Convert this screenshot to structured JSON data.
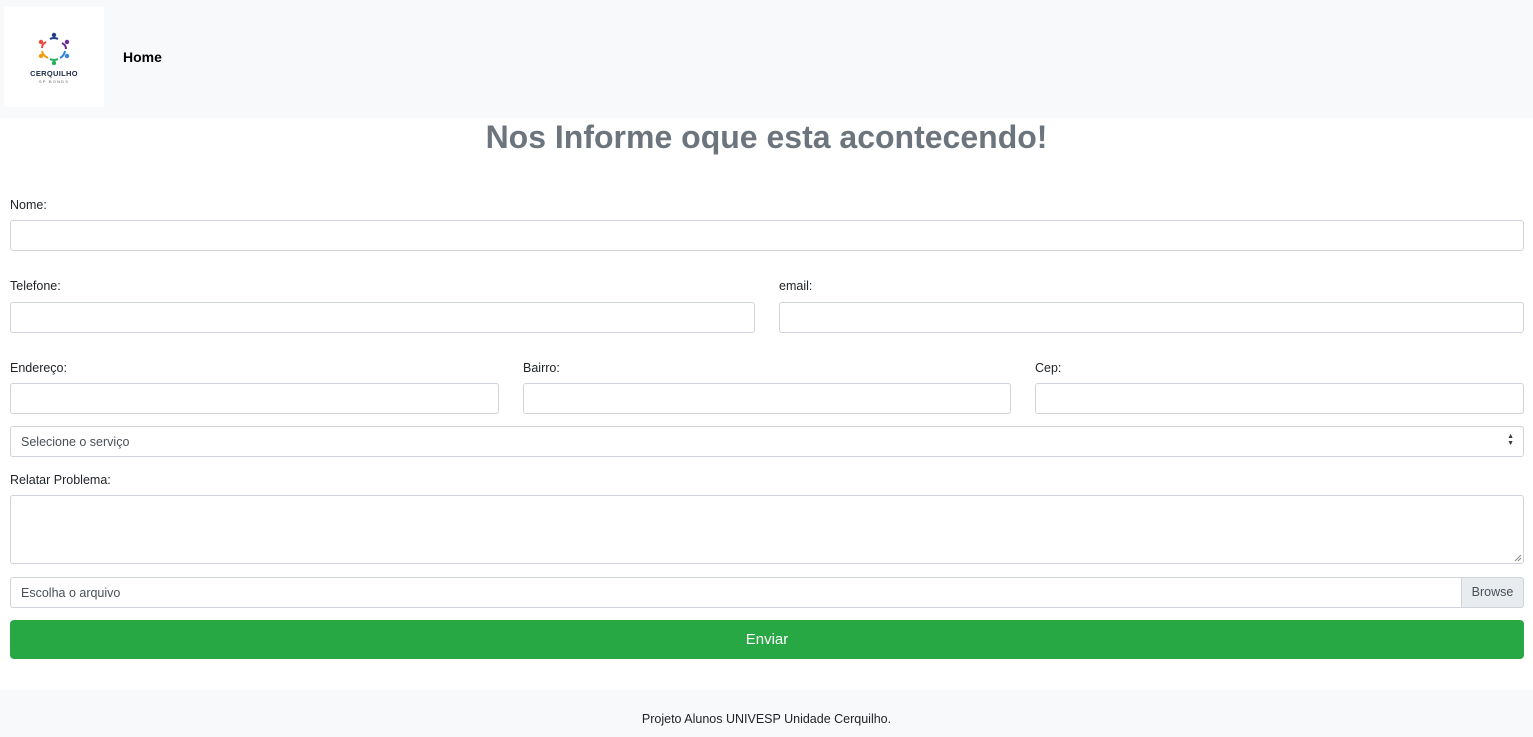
{
  "navbar": {
    "logo_text": "CERQUILHO",
    "logo_subtext": "SP BONDS",
    "home_label": "Home"
  },
  "page": {
    "title": "Nos Informe oque esta acontecendo!"
  },
  "form": {
    "nome_label": "Nome:",
    "nome_value": "",
    "telefone_label": "Telefone:",
    "telefone_value": "",
    "email_label": "email:",
    "email_value": "",
    "endereco_label": "Endereço:",
    "endereco_value": "",
    "bairro_label": "Bairro:",
    "bairro_value": "",
    "cep_label": "Cep:",
    "cep_value": "",
    "servico_selected": "Selecione o serviço",
    "problema_label": "Relatar Problema:",
    "file_placeholder": "Escolha o arquivo",
    "browse_label": "Browse",
    "submit_label": "Enviar"
  },
  "footer": {
    "text": "Projeto Alunos UNIVESP Unidade Cerquilho."
  },
  "colors": {
    "submit": "#28a745",
    "title": "#6c757d",
    "navbar_bg": "#f8f9fa"
  },
  "icons": {
    "logo": "people-circle-logo",
    "select": "select-arrows-icon",
    "textarea": "resize-grip-icon"
  }
}
